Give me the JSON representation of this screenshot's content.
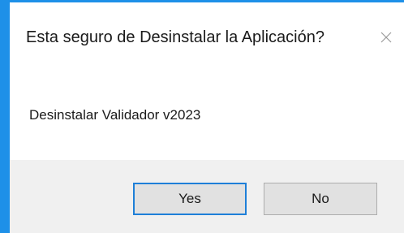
{
  "dialog": {
    "title": "Esta seguro de Desinstalar la Aplicación?",
    "close_icon": "close-icon",
    "message": "Desinstalar Validador v2023",
    "buttons": {
      "yes_label": "Yes",
      "no_label": "No"
    }
  },
  "colors": {
    "accent_border": "#1e90e8",
    "default_button_border": "#1e7fd8",
    "footer_background": "#f0f0f0",
    "button_background": "#e1e1e1"
  }
}
